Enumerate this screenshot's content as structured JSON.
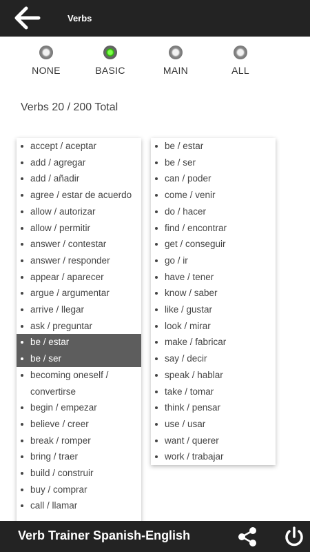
{
  "header": {
    "title": "Verbs",
    "back_icon": "arrow-left-icon"
  },
  "filters": [
    {
      "label": "NONE",
      "selected": false
    },
    {
      "label": "BASIC",
      "selected": true
    },
    {
      "label": "MAIN",
      "selected": false
    },
    {
      "label": "ALL",
      "selected": false
    }
  ],
  "summary": "Verbs 20 / 200 Total",
  "list_left": [
    {
      "text": "accept / aceptar",
      "highlighted": false
    },
    {
      "text": "add / agregar",
      "highlighted": false
    },
    {
      "text": "add / añadir",
      "highlighted": false
    },
    {
      "text": "agree / estar de acuerdo",
      "highlighted": false
    },
    {
      "text": "allow / autorizar",
      "highlighted": false
    },
    {
      "text": "allow / permitir",
      "highlighted": false
    },
    {
      "text": "answer / contestar",
      "highlighted": false
    },
    {
      "text": "answer / responder",
      "highlighted": false
    },
    {
      "text": "appear / aparecer",
      "highlighted": false
    },
    {
      "text": "argue / argumentar",
      "highlighted": false
    },
    {
      "text": "arrive / llegar",
      "highlighted": false
    },
    {
      "text": "ask / preguntar",
      "highlighted": false
    },
    {
      "text": "be / estar",
      "highlighted": true
    },
    {
      "text": "be / ser",
      "highlighted": true
    },
    {
      "text": "becoming oneself / convertirse",
      "highlighted": false
    },
    {
      "text": "begin / empezar",
      "highlighted": false
    },
    {
      "text": "believe / creer",
      "highlighted": false
    },
    {
      "text": "break / romper",
      "highlighted": false
    },
    {
      "text": "bring / traer",
      "highlighted": false
    },
    {
      "text": "build / construir",
      "highlighted": false
    },
    {
      "text": "buy / comprar",
      "highlighted": false
    },
    {
      "text": "call / llamar",
      "highlighted": false
    },
    {
      "text": "",
      "highlighted": true
    }
  ],
  "list_right": [
    "be / estar",
    "be / ser",
    "can / poder",
    "come / venir",
    "do / hacer",
    "find / encontrar",
    "get / conseguir",
    "go / ir",
    "have / tener",
    "know / saber",
    "like / gustar",
    "look / mirar",
    "make / fabricar",
    "say / decir",
    "speak / hablar",
    "take / tomar",
    "think / pensar",
    "use / usar",
    "want / querer",
    "work / trabajar"
  ],
  "footer": {
    "app_name": "Verb Trainer Spanish-English",
    "share_icon": "share-icon",
    "power_icon": "power-icon"
  }
}
